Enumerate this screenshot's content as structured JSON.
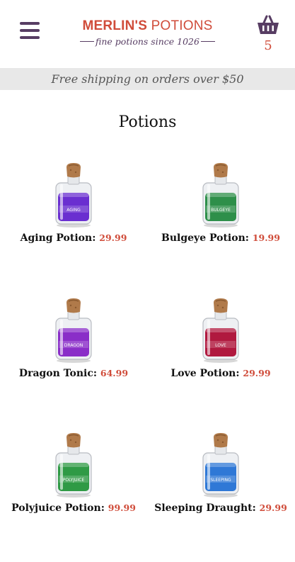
{
  "header": {
    "brand_bold": "MERLIN'S",
    "brand_light": "POTIONS",
    "tagline": "fine potions since 1026",
    "cart_count": "5",
    "icons": {
      "menu": "hamburger-menu-icon",
      "cart": "basket-icon"
    }
  },
  "banner": {
    "text": "Free shipping on orders over $50"
  },
  "page": {
    "title": "Potions"
  },
  "colors": {
    "accent": "#d04c3a",
    "brand": "#573d63",
    "banner_bg": "#e8e8e8"
  },
  "products": [
    {
      "name": "Aging Potion:",
      "price": "29.99",
      "label": "AGING",
      "liquid": "#6a2fd0"
    },
    {
      "name": "Bulgeye Potion:",
      "price": "19.99",
      "label": "BULGEYE",
      "liquid": "#2e8f4a"
    },
    {
      "name": "Dragon Tonic:",
      "price": "64.99",
      "label": "DRAGON",
      "liquid": "#8a2ec8"
    },
    {
      "name": "Love Potion:",
      "price": "29.99",
      "label": "LOVE",
      "liquid": "#b0193f"
    },
    {
      "name": "Polyjuice Potion:",
      "price": "99.99",
      "label": "POLYJUICE",
      "liquid": "#2f9a45"
    },
    {
      "name": "Sleeping Draught:",
      "price": "29.99",
      "label": "SLEEPING",
      "liquid": "#2f78d6"
    }
  ]
}
